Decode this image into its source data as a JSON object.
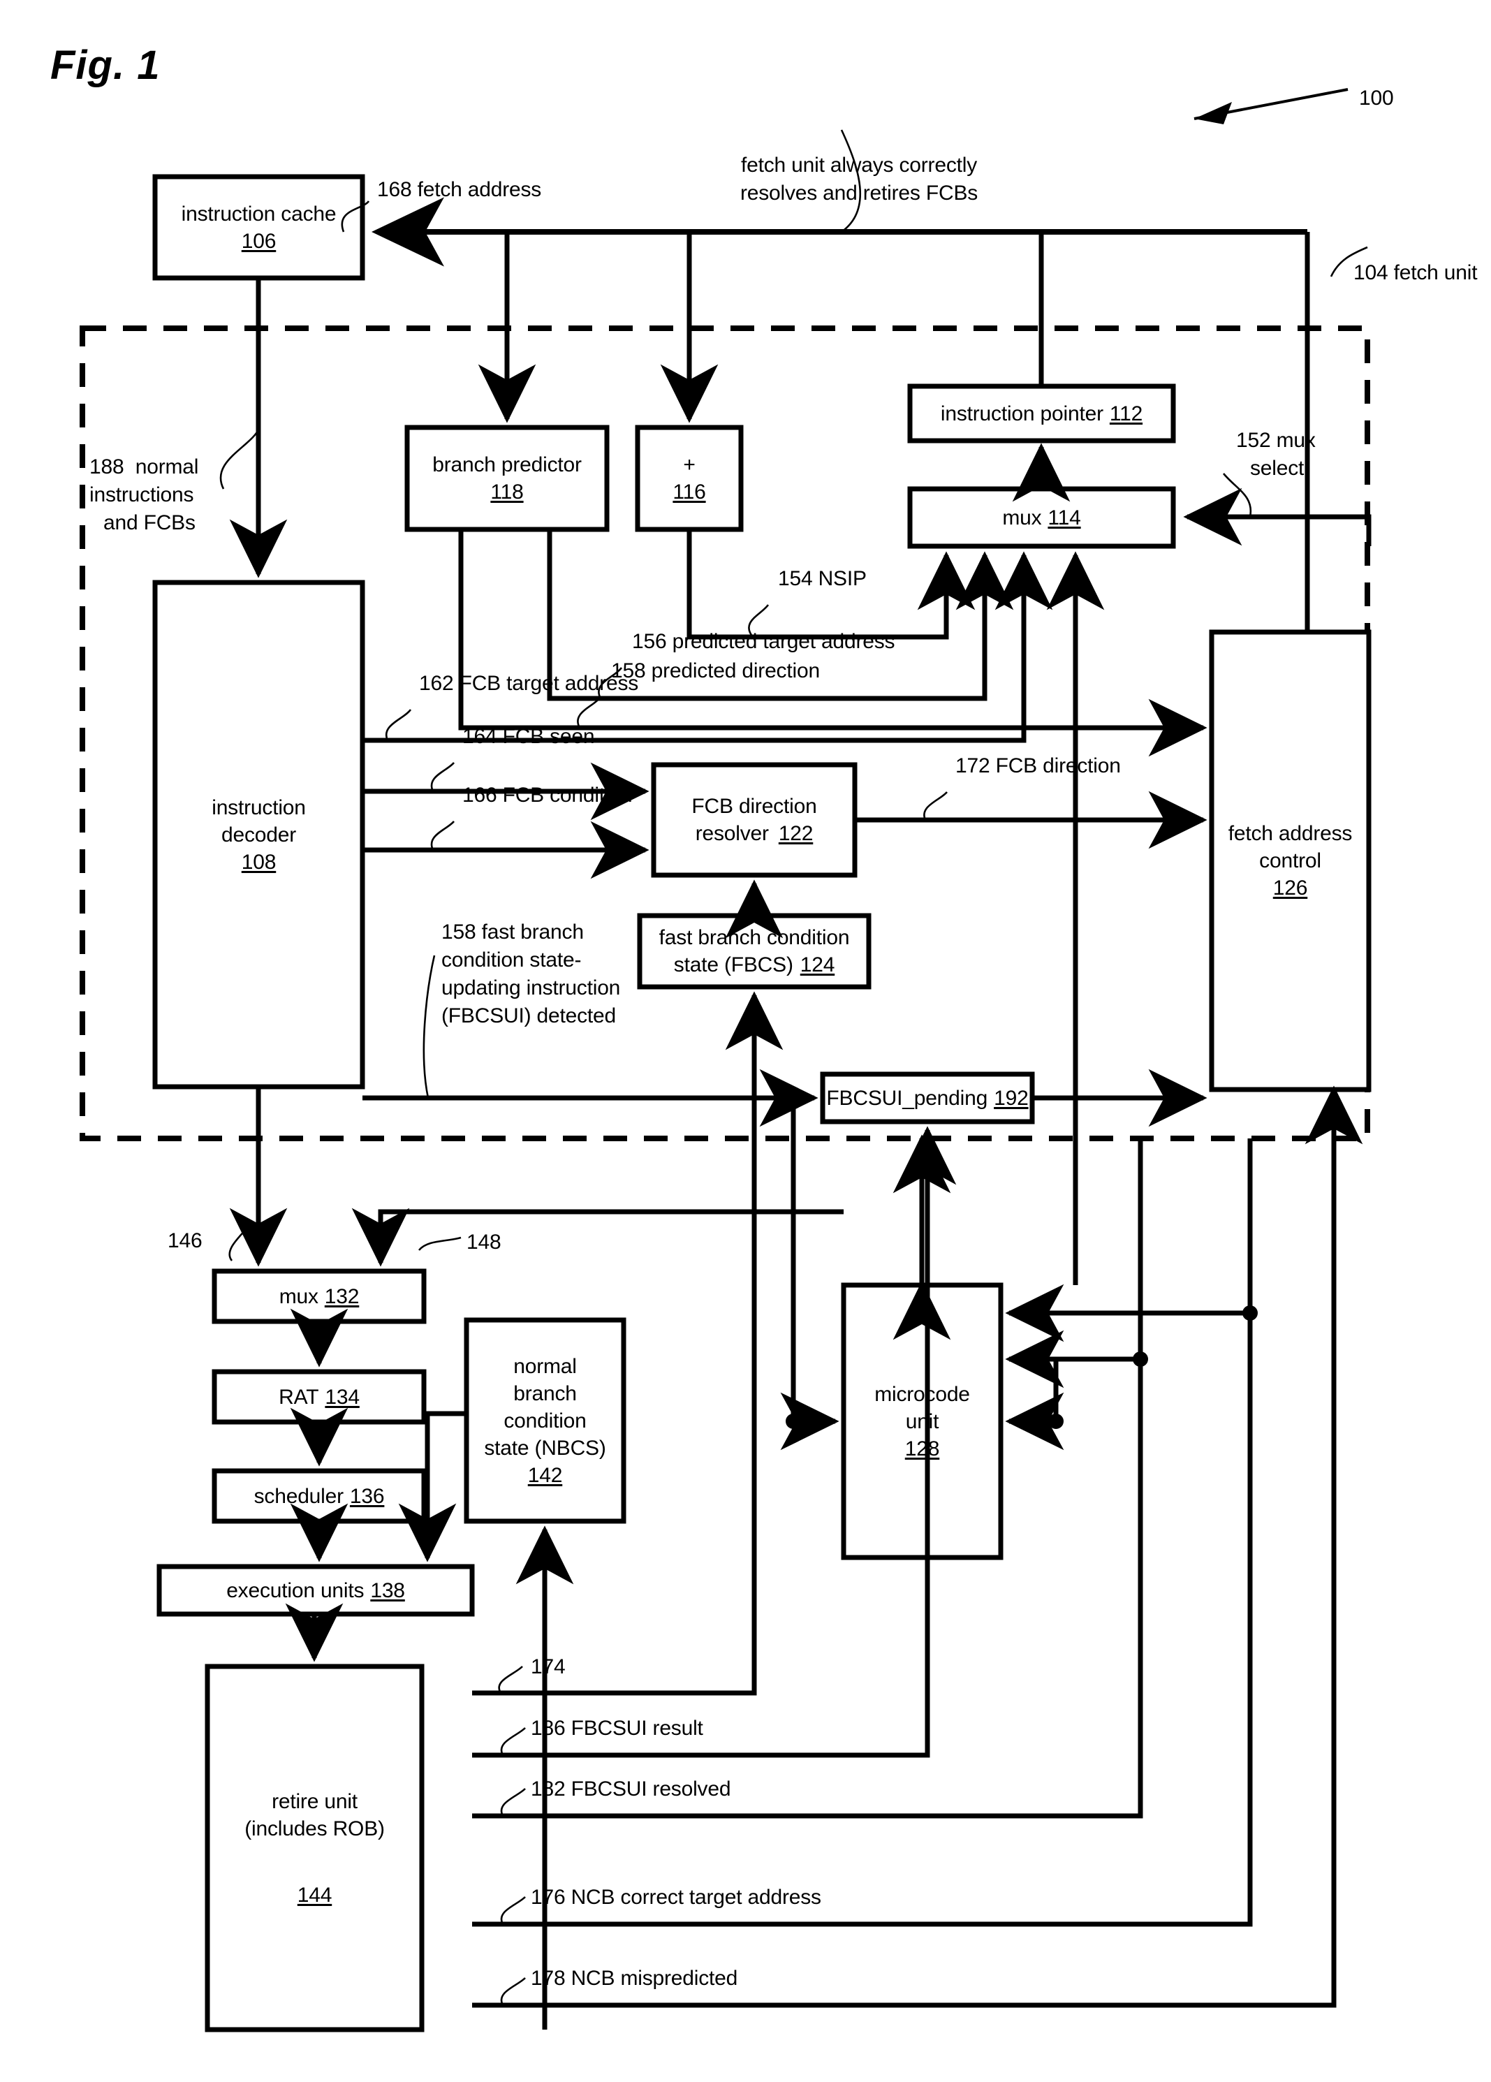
{
  "figure": {
    "title": "Fig. 1",
    "ref": "100"
  },
  "boundary": {
    "label": "104 fetch unit"
  },
  "annotations": {
    "fetch_address": "168 fetch address",
    "fetch_unit_note_line1": "fetch unit always correctly",
    "fetch_unit_note_line2": "resolves and retires FCBs",
    "normal_instructions_line1": "188  normal",
    "normal_instructions_line2": "instructions",
    "normal_instructions_line3": "and FCBs",
    "mux_select_line1": "152 mux",
    "mux_select_line2": "select",
    "nsip": "154 NSIP",
    "predicted_target_address": "156 predicted target address",
    "predicted_direction": "158 predicted direction",
    "fcb_target_address": "162 FCB target address",
    "fcb_seen": "164 FCB seen",
    "fcb_condition": "166 FCB condition",
    "fcb_direction": "172 FCB direction",
    "fbcsui_detected_line1": "158 fast branch",
    "fbcsui_detected_line2": "condition state-",
    "fbcsui_detected_line3": "updating instruction",
    "fbcsui_detected_line4": "(FBCSUI) detected",
    "sig_146": "146",
    "sig_148": "148",
    "sig_174": "174",
    "fbcsui_result": "186 FBCSUI result",
    "fbcsui_resolved": "182 FBCSUI resolved",
    "ncb_correct_target_address": "176 NCB correct target address",
    "ncb_mispredicted": "178 NCB mispredicted"
  },
  "blocks": {
    "instruction_cache": {
      "name": "instruction cache",
      "ref": "106"
    },
    "instruction_decoder": {
      "name_line1": "instruction",
      "name_line2": "decoder",
      "ref": "108"
    },
    "branch_predictor": {
      "name": "branch predictor",
      "ref": "118"
    },
    "adder": {
      "name": "+",
      "ref": "116"
    },
    "instruction_pointer": {
      "name": "instruction pointer",
      "ref": "112"
    },
    "mux_114": {
      "name": "mux",
      "ref": "114"
    },
    "fcb_direction_resolver": {
      "name_line1": "FCB direction",
      "name_line2": "resolver",
      "ref": "122"
    },
    "fbcs": {
      "name_line1": "fast branch condition",
      "name_line2": "state (FBCS)",
      "ref": "124"
    },
    "fetch_address_control": {
      "name_line1": "fetch address",
      "name_line2": "control",
      "ref": "126"
    },
    "fbcsui_pending": {
      "name": "FBCSUI_pending",
      "ref": "192"
    },
    "mux_132": {
      "name": "mux",
      "ref": "132"
    },
    "rat": {
      "name": "RAT",
      "ref": "134"
    },
    "scheduler": {
      "name": "scheduler",
      "ref": "136"
    },
    "nbcs": {
      "name_line1": "normal",
      "name_line2": "branch",
      "name_line3": "condition",
      "name_line4": "state (NBCS)",
      "ref": "142"
    },
    "execution_units": {
      "name": "execution units",
      "ref": "138"
    },
    "retire_unit": {
      "name_line1": "retire unit",
      "name_line2": "(includes ROB)",
      "ref": "144"
    },
    "microcode_unit": {
      "name_line1": "microcode",
      "name_line2": "unit",
      "ref": "128"
    }
  },
  "colors": {
    "stroke": "#000000",
    "background": "#ffffff"
  }
}
